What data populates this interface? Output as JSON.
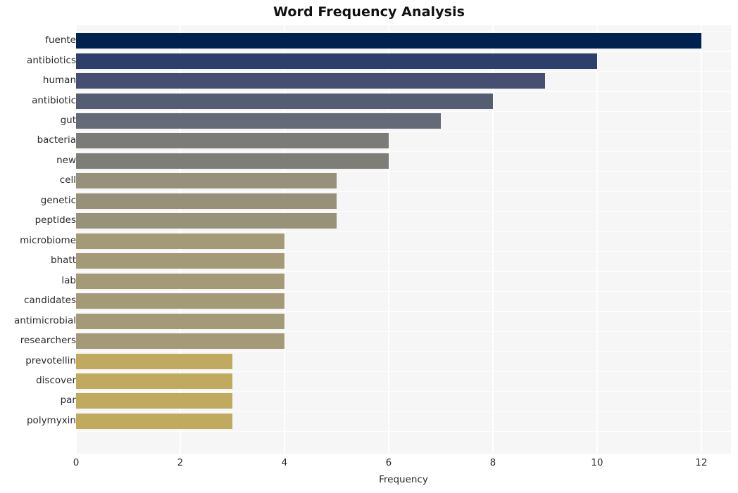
{
  "chart_data": {
    "type": "bar",
    "orientation": "horizontal",
    "title": "Word Frequency Analysis",
    "xlabel": "Frequency",
    "ylabel": "",
    "categories": [
      "fuente",
      "antibiotics",
      "human",
      "antibiotic",
      "gut",
      "bacteria",
      "new",
      "cell",
      "genetic",
      "peptides",
      "microbiome",
      "bhatt",
      "lab",
      "candidates",
      "antimicrobial",
      "researchers",
      "prevotellin",
      "discover",
      "par",
      "polymyxin"
    ],
    "values": [
      12,
      10,
      9,
      8,
      7,
      6,
      6,
      5,
      5,
      5,
      4,
      4,
      4,
      4,
      4,
      4,
      3,
      3,
      3,
      3
    ],
    "bar_colors": [
      "#00224e",
      "#2e3f6c",
      "#464f72",
      "#555d75",
      "#646a78",
      "#7b7b78",
      "#7e7d78",
      "#97907a",
      "#98917a",
      "#99927a",
      "#a49a78",
      "#a49a78",
      "#a49a78",
      "#a49a78",
      "#a49a78",
      "#a49a78",
      "#bfaa5f",
      "#bfaa5f",
      "#bfaa5f",
      "#bfaa5f"
    ],
    "xlim": [
      0,
      12.57
    ],
    "xticks": [
      0,
      2,
      4,
      6,
      8,
      10,
      12
    ],
    "xtick_labels": [
      "0",
      "2",
      "4",
      "6",
      "8",
      "10",
      "12"
    ],
    "grid": true,
    "grid_color": "#ffffff",
    "plot_background": "#f6f6f6",
    "figure_background": "#ffffff",
    "legend": null,
    "colormap": "cividis"
  }
}
